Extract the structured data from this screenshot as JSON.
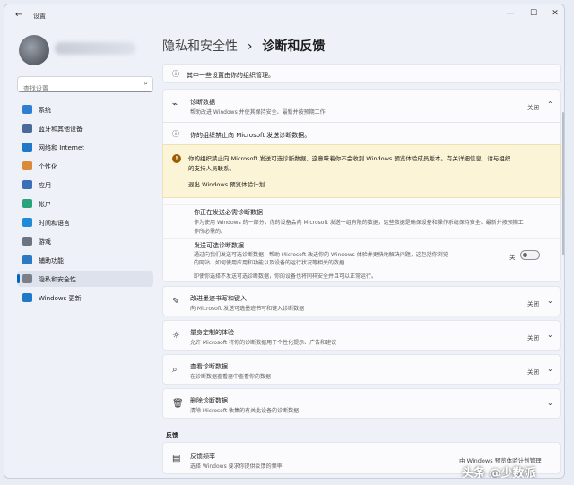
{
  "window": {
    "back_icon": "back-arrow-icon",
    "title": "设置",
    "controls": [
      "—",
      "☐",
      "✕"
    ]
  },
  "sidebar": {
    "search_placeholder": "查找设置",
    "items": [
      {
        "label": "系统",
        "icon": "system-icon",
        "color": "#2e7fd1"
      },
      {
        "label": "蓝牙和其他设备",
        "icon": "bluetooth-devices-icon",
        "color": "#4a6a9a"
      },
      {
        "label": "网络和 Internet",
        "icon": "network-icon",
        "color": "#1f78c8"
      },
      {
        "label": "个性化",
        "icon": "brush-icon",
        "color": "#d98a3a"
      },
      {
        "label": "应用",
        "icon": "apps-icon",
        "color": "#3c6fb6"
      },
      {
        "label": "帐户",
        "icon": "account-icon",
        "color": "#2aa37a"
      },
      {
        "label": "时间和语言",
        "icon": "time-language-icon",
        "color": "#1f8ad6"
      },
      {
        "label": "游戏",
        "icon": "gaming-icon",
        "color": "#6b7480"
      },
      {
        "label": "辅助功能",
        "icon": "accessibility-icon",
        "color": "#2d7ac4"
      },
      {
        "label": "隐私和安全性",
        "icon": "shield-icon",
        "color": "#7a7f88",
        "active": true
      },
      {
        "label": "Windows 更新",
        "icon": "windows-update-icon",
        "color": "#1f78c8"
      }
    ]
  },
  "breadcrumb": {
    "parent": "隐私和安全性",
    "separator": "›",
    "current": "诊断和反馈"
  },
  "org_notice": "其中一些设置由你的组织管理。",
  "diagnostic": {
    "title": "诊断数据",
    "desc": "帮助改进 Windows 并使其保持安全、最新并按预期工作",
    "state": "关闭",
    "blocked_notice": "你的组织禁止向 Microsoft 发送诊断数据。",
    "warning_line1": "你的组织禁止向 Microsoft 发送可选诊断数据，这意味着你不会收到 Windows 预览体验成员版本。有关详细信息，请与组织",
    "warning_line2": "的支持人员联系。",
    "warning_action": "退出 Windows 预览体验计划",
    "required_title": "你正在发送必需诊断数据",
    "required_desc1": "作为使用 Windows 的一部分，你的设备会向 Microsoft 发送一组有限的数据，这些数据是确保设备和操作系统保持安全、最新并按预期工",
    "required_desc2": "作所必需的。",
    "optional_title": "发送可选诊断数据",
    "optional_desc1": "通过向我们发送可选诊断数据，帮助 Microsoft 改进你的 Windows 体验并更快地解决问题，这包括你浏览",
    "optional_desc2": "的网站、如何使用应用和功能以及设备的运行状况等相关的数据",
    "optional_toggle_label": "关",
    "optional_note": "即使你选择不发送可选诊断数据，你的设备也将同样安全并且可以正常运行。"
  },
  "settings_rows": [
    {
      "icon": "pen-icon",
      "title": "改进墨迹书写和键入",
      "desc": "向 Microsoft 发送可选墨迹书写和键入诊断数据",
      "state": "关闭"
    },
    {
      "icon": "lightbulb-icon",
      "title": "量身定制的体验",
      "desc": "允许 Microsoft 将你的诊断数据用于个性化提示、广告和建议",
      "state": "关闭"
    },
    {
      "icon": "viewer-icon",
      "title": "查看诊断数据",
      "desc": "在诊断数据查看器中查看你的数据",
      "state": "关闭"
    },
    {
      "icon": "trash-icon",
      "title": "删除诊断数据",
      "desc": "清除 Microsoft 收集的有关此设备的诊断数据",
      "state": ""
    }
  ],
  "feedback": {
    "section_title": "反馈",
    "row_title": "反馈频率",
    "row_desc": "选择 Windows 要求你提供反馈的频率",
    "row_value": "由 Windows 预览体验计划管理"
  },
  "watermark": "头条 @少数派"
}
